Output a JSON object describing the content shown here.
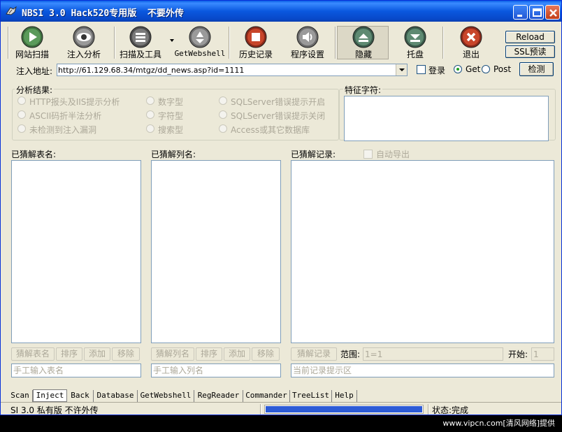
{
  "window": {
    "title": "NBSI 3.0 Hack520专用版  不要外传"
  },
  "toolbar": {
    "items": [
      {
        "label": "网站扫描",
        "icon": "play-icon"
      },
      {
        "label": "注入分析",
        "icon": "eye-icon"
      },
      {
        "label": "扫描及工具",
        "icon": "list-icon"
      },
      {
        "label": "GetWebshell",
        "icon": "recycle-icon"
      },
      {
        "label": "历史记录",
        "icon": "stop-icon"
      },
      {
        "label": "程序设置",
        "icon": "speaker-icon"
      },
      {
        "label": "隐藏",
        "icon": "hide-icon"
      },
      {
        "label": "托盘",
        "icon": "tray-icon"
      },
      {
        "label": "退出",
        "icon": "exit-icon"
      }
    ],
    "reload": "Reload",
    "ssl": "SSL预读"
  },
  "url_row": {
    "label": "注入地址:",
    "value": "http://61.129.68.34/mtgz/dd_news.asp?id=1111",
    "login_label": "登录",
    "login_checked": false,
    "get_label": "Get",
    "post_label": "Post",
    "method": "Get",
    "detect_button": "检测"
  },
  "analysis": {
    "title": "分析结果:",
    "col1": [
      "HTTP报头及IIS提示分析",
      "ASCII码折半法分析",
      "未检测到注入漏洞"
    ],
    "col2": [
      "数字型",
      "字符型",
      "搜索型"
    ],
    "col3": [
      "SQLServer错误提示开启",
      "SQLServer错误提示关闭",
      "Access或其它数据库"
    ],
    "feature_label": "特征字符:"
  },
  "tables": {
    "label": "已猜解表名:",
    "buttons": [
      "猜解表名",
      "排序",
      "添加",
      "移除"
    ],
    "input_placeholder": "手工输入表名"
  },
  "columns": {
    "label": "已猜解列名:",
    "buttons": [
      "猜解列名",
      "排序",
      "添加",
      "移除"
    ],
    "input_placeholder": "手工输入列名"
  },
  "records": {
    "label": "已猜解记录:",
    "auto_export": "自动导出",
    "guess_button": "猜解记录",
    "range_label": "范围:",
    "range_value": "1=1",
    "start_label": "开始:",
    "start_value": "1",
    "hint_placeholder": "当前记录提示区"
  },
  "tabs": [
    "Scan",
    "Inject",
    "Back",
    "Database",
    "GetWebshell",
    "RegReader",
    "Commander",
    "TreeList",
    "Help"
  ],
  "active_tab": "Inject",
  "status": {
    "left": "SI 3.0 私有版 不许外传",
    "progress": 1.0,
    "right": "状态:完成"
  },
  "watermark": "www.vipcn.com[清风网络]提供"
}
